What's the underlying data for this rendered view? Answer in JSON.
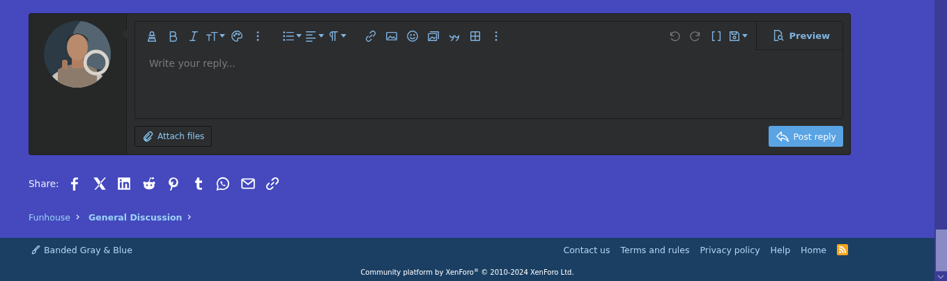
{
  "editor": {
    "placeholder": "Write your reply...",
    "preview": "Preview",
    "attach": "Attach files",
    "post": "Post reply"
  },
  "share": {
    "label": "Share:"
  },
  "breadcrumbs": [
    {
      "label": "Funhouse",
      "current": false
    },
    {
      "label": "General Discussion",
      "current": true
    }
  ],
  "footer": {
    "style": "Banded Gray & Blue",
    "links": [
      "Contact us",
      "Terms and rules",
      "Privacy policy",
      "Help",
      "Home"
    ],
    "copyright": "Community platform by XenForo$^{®}$ © 2010-2024 XenForo Ltd."
  }
}
